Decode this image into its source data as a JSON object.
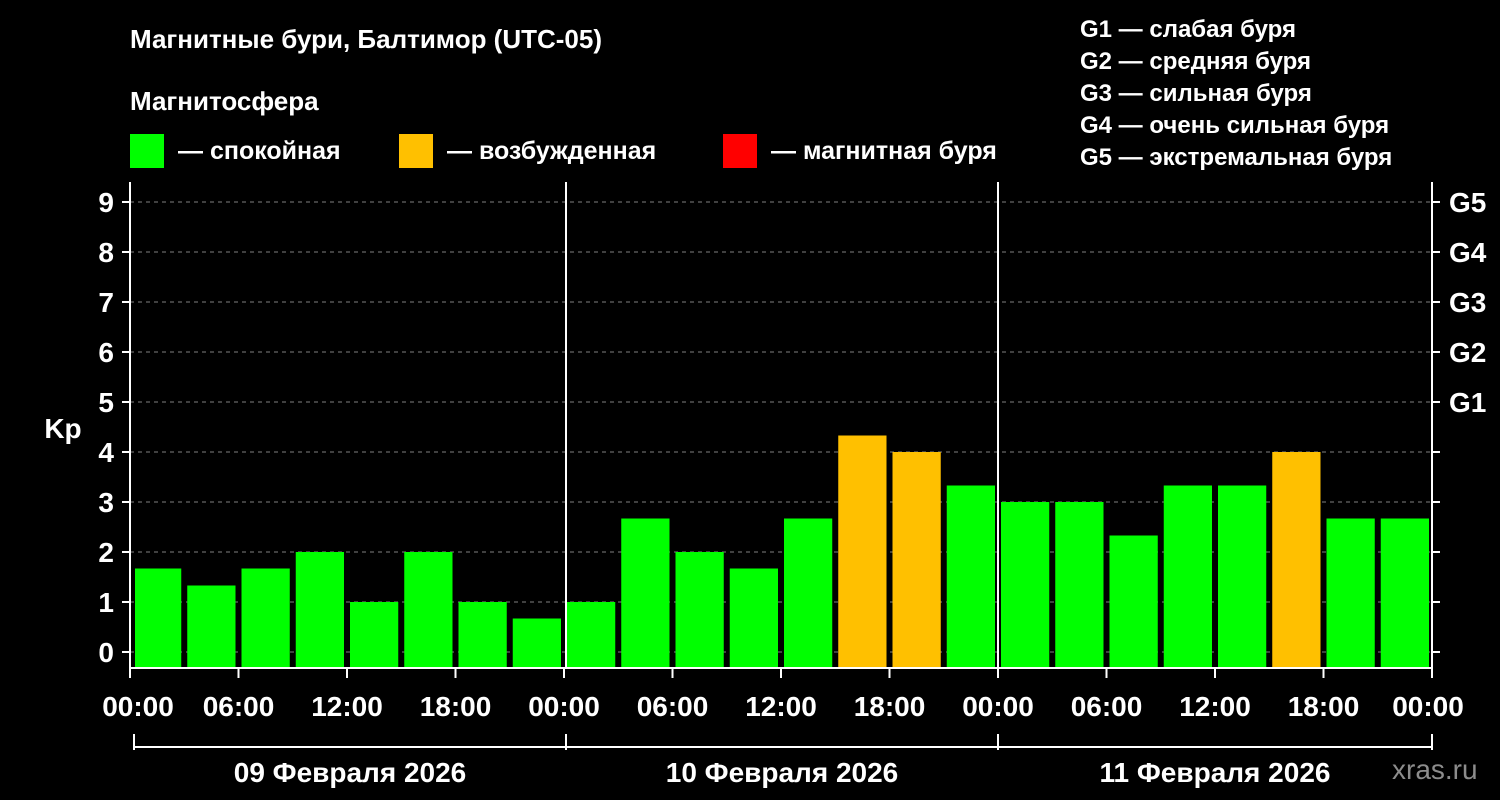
{
  "chart_data": {
    "type": "bar",
    "title": "Магнитные бури, Балтимор (UTC-05)",
    "subtitle": "Магнитосфера",
    "ylabel": "Kp",
    "ylim": [
      0,
      9
    ],
    "y_ticks": [
      "0",
      "1",
      "2",
      "3",
      "4",
      "5",
      "6",
      "7",
      "8",
      "9"
    ],
    "g_scale": [
      {
        "label": "G1",
        "kp": 5
      },
      {
        "label": "G2",
        "kp": 6
      },
      {
        "label": "G3",
        "kp": 7
      },
      {
        "label": "G4",
        "kp": 8
      },
      {
        "label": "G5",
        "kp": 9
      }
    ],
    "x_tick_labels": [
      "00:00",
      "06:00",
      "12:00",
      "18:00",
      "00:00",
      "06:00",
      "12:00",
      "18:00",
      "00:00",
      "06:00",
      "12:00",
      "18:00",
      "00:00"
    ],
    "day_labels": [
      "09 Февраля 2026",
      "10 Февраля 2026",
      "11 Февраля 2026"
    ],
    "categories": [
      "09.02 00:00",
      "09.02 03:00",
      "09.02 06:00",
      "09.02 09:00",
      "09.02 12:00",
      "09.02 15:00",
      "09.02 18:00",
      "09.02 21:00",
      "10.02 00:00",
      "10.02 03:00",
      "10.02 06:00",
      "10.02 09:00",
      "10.02 12:00",
      "10.02 15:00",
      "10.02 18:00",
      "10.02 21:00",
      "11.02 00:00",
      "11.02 03:00",
      "11.02 06:00",
      "11.02 09:00",
      "11.02 12:00",
      "11.02 15:00",
      "11.02 18:00",
      "11.02 21:00"
    ],
    "values": [
      1.33,
      1.67,
      1.33,
      1.67,
      2.0,
      1.0,
      2.0,
      1.0,
      0.67,
      1.0,
      2.67,
      2.0,
      1.67,
      2.67,
      4.33,
      4.0,
      3.33,
      3.0,
      3.0,
      2.33,
      3.33,
      3.33,
      4.0,
      2.67,
      2.67
    ],
    "legend": [
      {
        "label": "— спокойная",
        "color": "#00ff00"
      },
      {
        "label": "— возбужденная",
        "color": "#ffc000"
      },
      {
        "label": "— магнитная буря",
        "color": "#ff0000"
      }
    ],
    "storm_levels": [
      "G1 — слабая буря",
      "G2 — средняя буря",
      "G3 — сильная буря",
      "G4 — очень сильная буря",
      "G5 — экстремальная буря"
    ],
    "grid": true
  },
  "credit": "xras.ru"
}
